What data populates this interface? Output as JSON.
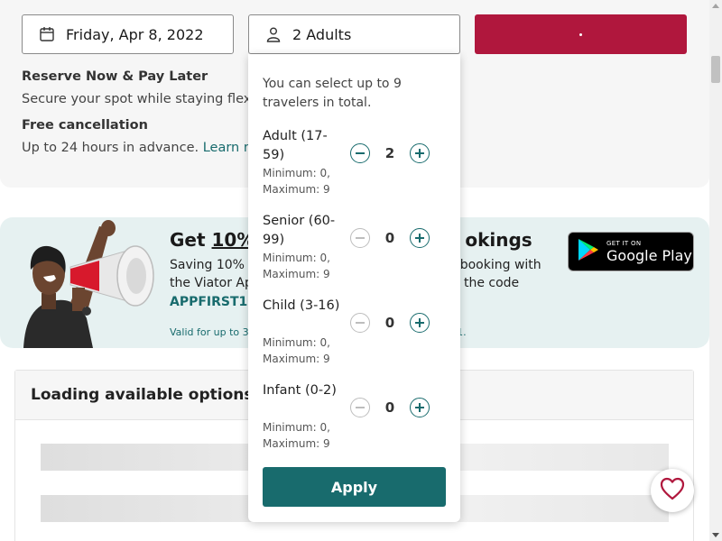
{
  "booking": {
    "date_value": "Friday, Apr 8, 2022",
    "travelers_value": "2 Adults",
    "check_button_state": "loading"
  },
  "info": {
    "reserve_title": "Reserve Now & Pay Later",
    "reserve_text": "Secure your spot while staying flexib",
    "cancel_title": "Free cancellation",
    "cancel_text": "Up to 24 hours in advance.",
    "learn_more": "Learn mo"
  },
  "promo": {
    "head_prefix": "Get",
    "head_highlight": "10%",
    "head_tail": "okings",
    "line1_left": "Saving 10% o",
    "line1_right": "s booking with",
    "line2_left": "the Viator Ap",
    "line2_right": "e the code",
    "code": "APPFIRST10",
    "valid_left": "Valid for up to 3 b",
    "valid_right": "1.",
    "gplay_small": "GET IT ON",
    "gplay_big": "Google Play"
  },
  "loading": {
    "title": "Loading available options"
  },
  "travelers": {
    "note": "You can select up to 9 travelers in total.",
    "rows": [
      {
        "label": "Adult (17-59)",
        "sub": "Minimum: 0, Maximum: 9",
        "count": "2",
        "minus_enabled": true
      },
      {
        "label": "Senior (60-99)",
        "sub": "Minimum: 0, Maximum: 9",
        "count": "0",
        "minus_enabled": false
      },
      {
        "label": "Child (3-16)",
        "sub": "Minimum: 0, Maximum: 9",
        "count": "0",
        "minus_enabled": false
      },
      {
        "label": "Infant (0-2)",
        "sub": "Minimum: 0, Maximum: 9",
        "count": "0",
        "minus_enabled": false
      }
    ],
    "apply_label": "Apply"
  },
  "colors": {
    "brand_red": "#b0173d",
    "brand_teal": "#186b6d",
    "banner_bg": "#e6f1f1"
  },
  "icons": {
    "date": "calendar-icon",
    "travelers": "person-icon",
    "wishlist": "heart-icon",
    "store": "google-play-icon"
  }
}
